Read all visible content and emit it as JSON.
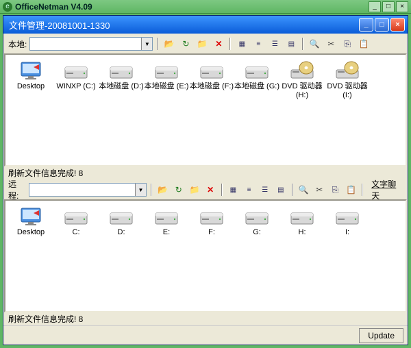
{
  "outer": {
    "title": "OfficeNetman V4.09"
  },
  "inner": {
    "title": "文件管理-20081001-1330"
  },
  "local": {
    "label": "本地:",
    "status": "刷新文件信息完成! 8",
    "items": [
      {
        "name": "Desktop",
        "type": "desktop"
      },
      {
        "name": "WINXP (C:)",
        "type": "drive"
      },
      {
        "name": "本地磁盘 (D:)",
        "type": "drive"
      },
      {
        "name": "本地磁盘 (E:)",
        "type": "drive"
      },
      {
        "name": "本地磁盘 (F:)",
        "type": "drive"
      },
      {
        "name": "本地磁盘 (G:)",
        "type": "drive"
      },
      {
        "name": "DVD 驱动器 (H:)",
        "type": "cd"
      },
      {
        "name": "DVD 驱动器 (I:)",
        "type": "cd"
      }
    ]
  },
  "remote": {
    "label": "远程:",
    "chat": "文字聊天",
    "status": "刷新文件信息完成!  8",
    "items": [
      {
        "name": "Desktop",
        "type": "desktop"
      },
      {
        "name": "C:",
        "type": "drive"
      },
      {
        "name": "D:",
        "type": "drive"
      },
      {
        "name": "E:",
        "type": "drive"
      },
      {
        "name": "F:",
        "type": "drive"
      },
      {
        "name": "G:",
        "type": "drive"
      },
      {
        "name": "H:",
        "type": "drive"
      },
      {
        "name": "I:",
        "type": "drive"
      }
    ]
  },
  "buttons": {
    "update": "Update"
  }
}
